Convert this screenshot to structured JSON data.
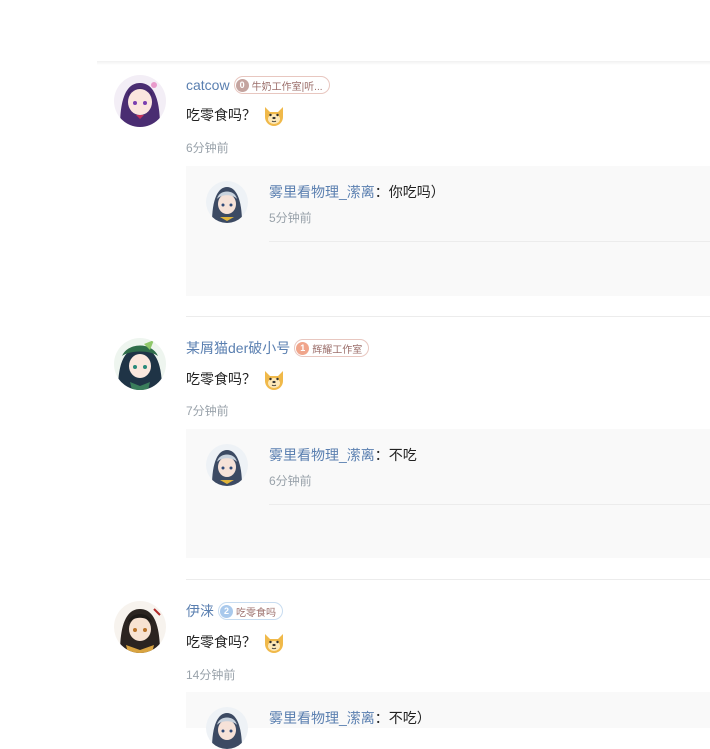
{
  "comments": [
    {
      "username": "catcow",
      "medal_level": "0",
      "medal_text": "牛奶工作室|听...",
      "medal_color": "#c4a49f",
      "content": "吃零食吗？",
      "emoji": "doge-emoji",
      "time": "6分钟前",
      "reply": {
        "username": "雾里看物理_潆离",
        "separator": "：",
        "text": "你吃吗）",
        "time": "5分钟前"
      }
    },
    {
      "username": "某屑猫der破小号",
      "medal_level": "1",
      "medal_text": "辉耀工作室",
      "medal_color": "#f0a58b",
      "content": "吃零食吗？",
      "emoji": "doge-emoji",
      "time": "7分钟前",
      "reply": {
        "username": "雾里看物理_潆离",
        "separator": "：",
        "text": "不吃",
        "time": "6分钟前"
      }
    },
    {
      "username": "伊涞",
      "medal_level": "2",
      "medal_text": "吃零食吗",
      "medal_color": "#a9c9ec",
      "content": "吃零食吗？",
      "emoji": "doge-emoji",
      "time": "14分钟前",
      "reply": {
        "username": "雾里看物理_潆离",
        "separator": "：",
        "text": "不吃）"
      }
    }
  ]
}
